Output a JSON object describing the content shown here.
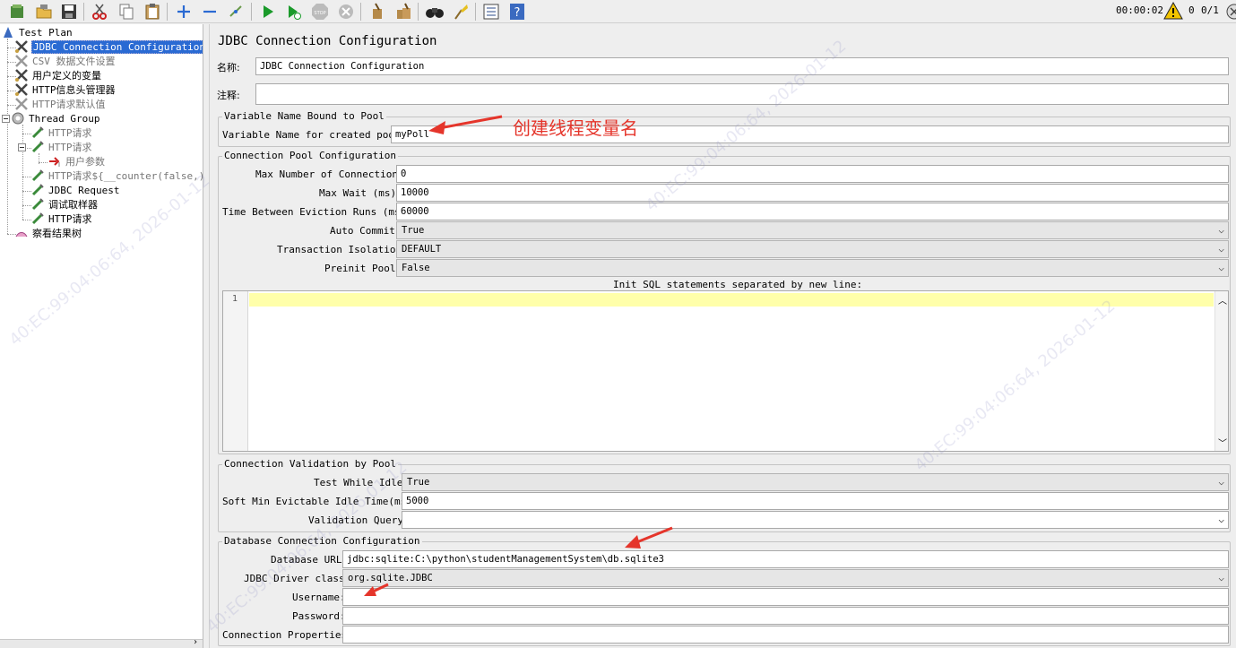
{
  "toolbar": {
    "timer": "00:00:02",
    "warnings": "0",
    "threads": "0/1",
    "icons": [
      "templates-icon",
      "open-icon",
      "save-icon",
      "cut-icon",
      "copy-icon",
      "paste-icon",
      "expand-icon",
      "collapse-icon",
      "toggle-icon",
      "start-icon",
      "start-no-pause-icon",
      "stop-icon",
      "shutdown-icon",
      "clear-icon",
      "clear-all-icon",
      "search-icon",
      "reset-search-icon",
      "function-helper-icon",
      "help-icon"
    ]
  },
  "tree": {
    "items": [
      {
        "label": "Test Plan"
      },
      {
        "label": "JDBC Connection Configuration"
      },
      {
        "label": "CSV 数据文件设置"
      },
      {
        "label": "用户定义的变量"
      },
      {
        "label": "HTTP信息头管理器"
      },
      {
        "label": "HTTP请求默认值"
      },
      {
        "label": "Thread Group"
      },
      {
        "label": "HTTP请求"
      },
      {
        "label": "HTTP请求"
      },
      {
        "label": "用户参数"
      },
      {
        "label": "HTTP请求${__counter(false,)}"
      },
      {
        "label": "JDBC Request"
      },
      {
        "label": "调试取样器"
      },
      {
        "label": "HTTP请求"
      },
      {
        "label": "察看结果树"
      }
    ]
  },
  "main": {
    "title": "JDBC Connection Configuration",
    "name_label": "名称:",
    "name_value": "JDBC Connection Configuration",
    "comment_label": "注释:",
    "comment_value": "",
    "var_group": {
      "title": "Variable Name Bound to Pool",
      "label": "Variable Name for created pool:",
      "value": "myPoll"
    },
    "pool_group": {
      "title": "Connection Pool Configuration",
      "max_conn_label": "Max Number of Connections:",
      "max_conn_value": "0",
      "max_wait_label": "Max Wait (ms):",
      "max_wait_value": "10000",
      "eviction_label": "Time Between Eviction Runs (ms):",
      "eviction_value": "60000",
      "auto_commit_label": "Auto Commit:",
      "auto_commit_value": "True",
      "isolation_label": "Transaction Isolation:",
      "isolation_value": "DEFAULT",
      "preinit_label": "Preinit Pool:",
      "preinit_value": "False",
      "init_sql_label": "Init SQL statements separated by new line:",
      "init_sql_line": "1"
    },
    "validation_group": {
      "title": "Connection Validation by Pool",
      "test_idle_label": "Test While Idle:",
      "test_idle_value": "True",
      "soft_min_label": "Soft Min Evictable Idle Time(ms):",
      "soft_min_value": "5000",
      "query_label": "Validation Query:",
      "query_value": ""
    },
    "db_group": {
      "title": "Database Connection Configuration",
      "url_label": "Database URL:",
      "url_value": "jdbc:sqlite:C:\\python\\studentManagementSystem\\db.sqlite3",
      "driver_label": "JDBC Driver class:",
      "driver_value": "org.sqlite.JDBC",
      "username_label": "Username:",
      "username_value": "",
      "password_label": "Password:",
      "password_value": "",
      "props_label": "Connection Properties:",
      "props_value": ""
    }
  },
  "annotation": {
    "text": "创建线程变量名",
    "color": "#e5352b"
  },
  "watermark": "40:EC:99:04:06:64, 2026-01-12"
}
